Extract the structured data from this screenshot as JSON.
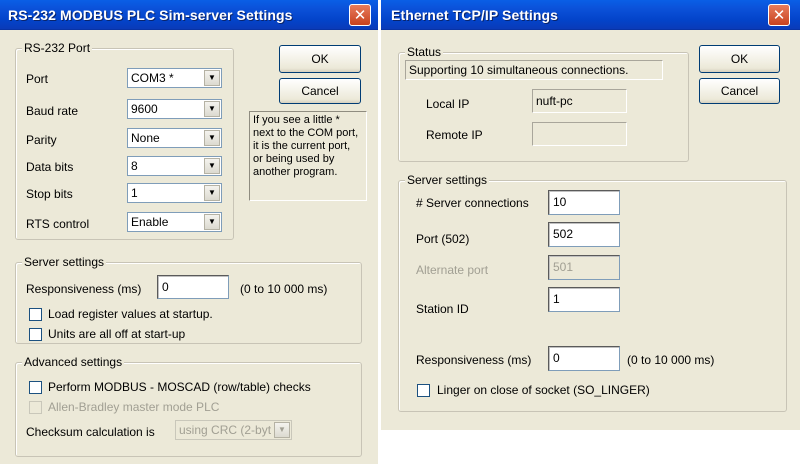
{
  "left_dialog": {
    "title": "RS-232 MODBUS PLC Sim-server Settings",
    "close_label": "✕",
    "ok_label": "OK",
    "cancel_label": "Cancel",
    "rs232_group": {
      "legend": "RS-232 Port",
      "port_label": "Port",
      "port_value": "COM3 *",
      "baud_label": "Baud rate",
      "baud_value": "9600",
      "parity_label": "Parity",
      "parity_value": "None",
      "databits_label": "Data bits",
      "databits_value": "8",
      "stopbits_label": "Stop bits",
      "stopbits_value": "1",
      "rts_label": "RTS control",
      "rts_value": "Enable"
    },
    "info_text": "If you see a little * next to the COM port, it is the current port, or being used by another program.",
    "server_group": {
      "legend": "Server settings",
      "responsiveness_label": "Responsiveness (ms)",
      "responsiveness_value": "0",
      "responsiveness_range": "(0 to 10 000 ms)",
      "load_register_label": "Load register values at startup.",
      "units_off_label": "Units are all off at start-up"
    },
    "advanced_group": {
      "legend": "Advanced settings",
      "moscad_label": "Perform MODBUS - MOSCAD (row/table) checks",
      "allen_bradley_label": "Allen-Bradley master mode PLC",
      "checksum_label": "Checksum calculation is",
      "checksum_value": "using CRC (2-byt"
    }
  },
  "right_dialog": {
    "title": "Ethernet TCP/IP Settings",
    "close_label": "✕",
    "ok_label": "OK",
    "cancel_label": "Cancel",
    "status_group": {
      "legend": "Status",
      "status_text": "Supporting 10 simultaneous connections.",
      "local_ip_label": "Local IP",
      "local_ip_value": "nuft-pc",
      "remote_ip_label": "Remote IP",
      "remote_ip_value": ""
    },
    "server_group": {
      "legend": "Server settings",
      "connections_label": "# Server connections",
      "connections_value": "10",
      "port_label": "Port (502)",
      "port_value": "502",
      "alt_port_label": "Alternate port",
      "alt_port_value": "501",
      "station_label": "Station ID",
      "station_value": "1",
      "responsiveness_label": "Responsiveness (ms)",
      "responsiveness_value": "0",
      "responsiveness_range": "(0 to 10 000 ms)",
      "linger_label": "Linger on close of socket (SO_LINGER)"
    }
  }
}
